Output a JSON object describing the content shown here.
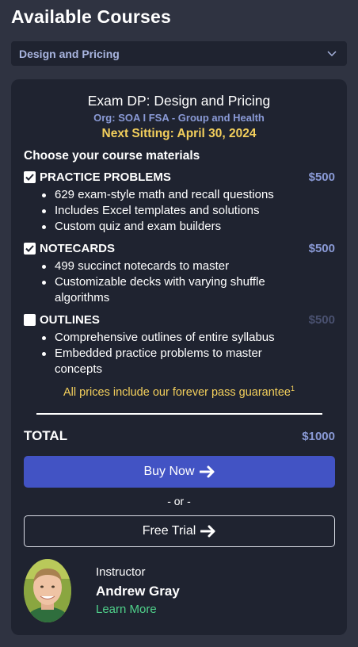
{
  "page": {
    "title": "Available Courses"
  },
  "course_select": {
    "value": "Design and Pricing",
    "icon": "chevron-down-icon"
  },
  "course": {
    "title": "Exam DP: Design and Pricing",
    "org": "Org: SOA I FSA - Group and Health",
    "sitting": "Next Sitting: April 30, 2024",
    "choose_label": "Choose your course materials",
    "items": [
      {
        "name": "PRACTICE PROBLEMS",
        "price": "$500",
        "checked": true,
        "bullets": [
          "629 exam-style math and recall questions",
          "Includes Excel templates and solutions",
          "Custom quiz and exam builders"
        ]
      },
      {
        "name": "NOTECARDS",
        "price": "$500",
        "checked": true,
        "bullets": [
          "499 succinct notecards to master",
          "Customizable decks with varying shuffle algorithms"
        ]
      },
      {
        "name": "OUTLINES",
        "price": "$500",
        "checked": false,
        "bullets": [
          "Comprehensive outlines of entire syllabus",
          "Embedded practice problems to master concepts"
        ]
      }
    ],
    "guarantee": "All prices include our forever pass guarantee",
    "guarantee_sup": "1",
    "total_label": "TOTAL",
    "total_amount": "$1000",
    "buy_label": "Buy Now",
    "or_label": "- or -",
    "trial_label": "Free Trial"
  },
  "instructor": {
    "label": "Instructor",
    "name": "Andrew Gray",
    "link": "Learn More"
  },
  "colors": {
    "background": "#2f3341",
    "card": "#1f2330",
    "accent": "#8a9ad6",
    "highlight": "#f3cf5c",
    "button": "#4253c4",
    "link": "#4fd08a"
  }
}
